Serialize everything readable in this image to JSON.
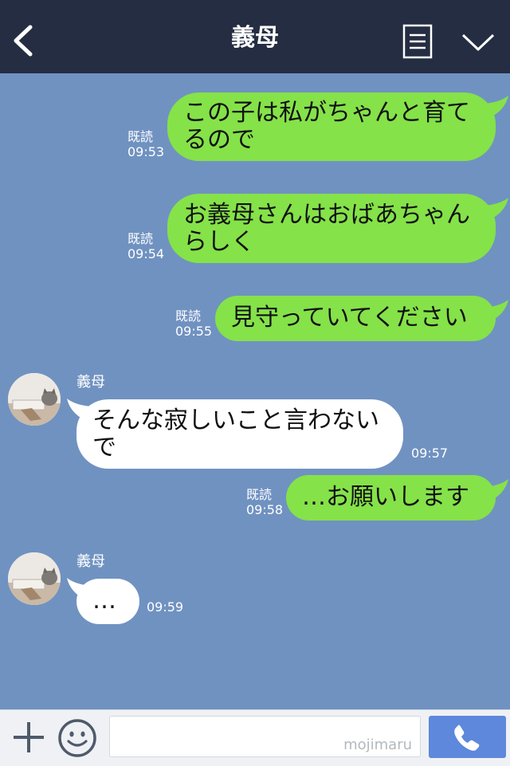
{
  "header": {
    "title": "義母",
    "icons": {
      "back": "chevron-left-icon",
      "notes": "notes-icon",
      "menu": "chevron-down-icon"
    }
  },
  "messages": [
    {
      "side": "sent",
      "text": "この子は私がちゃんと育て\nるので",
      "read": "既読",
      "time": "09:53"
    },
    {
      "side": "sent",
      "text": "お義母さんはおばあちゃん\nらしく",
      "read": "既読",
      "time": "09:54"
    },
    {
      "side": "sent",
      "text": "見守っていてください",
      "read": "既読",
      "time": "09:55"
    },
    {
      "side": "recv",
      "sender": "義母",
      "text": "そんな寂しいこと言わない\nで",
      "time": "09:57"
    },
    {
      "side": "sent",
      "text": "…お願いします",
      "read": "既読",
      "time": "09:58"
    },
    {
      "side": "recv",
      "sender": "義母",
      "text": "…",
      "time": "09:59"
    }
  ],
  "input_bar": {
    "watermark": "mojimaru",
    "icons": {
      "add": "plus-icon",
      "emoji": "emoji-icon",
      "call": "phone-icon"
    }
  },
  "colors": {
    "header_bg": "#252d42",
    "chat_bg": "#7092c1",
    "sent_bubble": "#85e249",
    "received_bubble": "#ffffff",
    "call_button": "#5d88db"
  }
}
